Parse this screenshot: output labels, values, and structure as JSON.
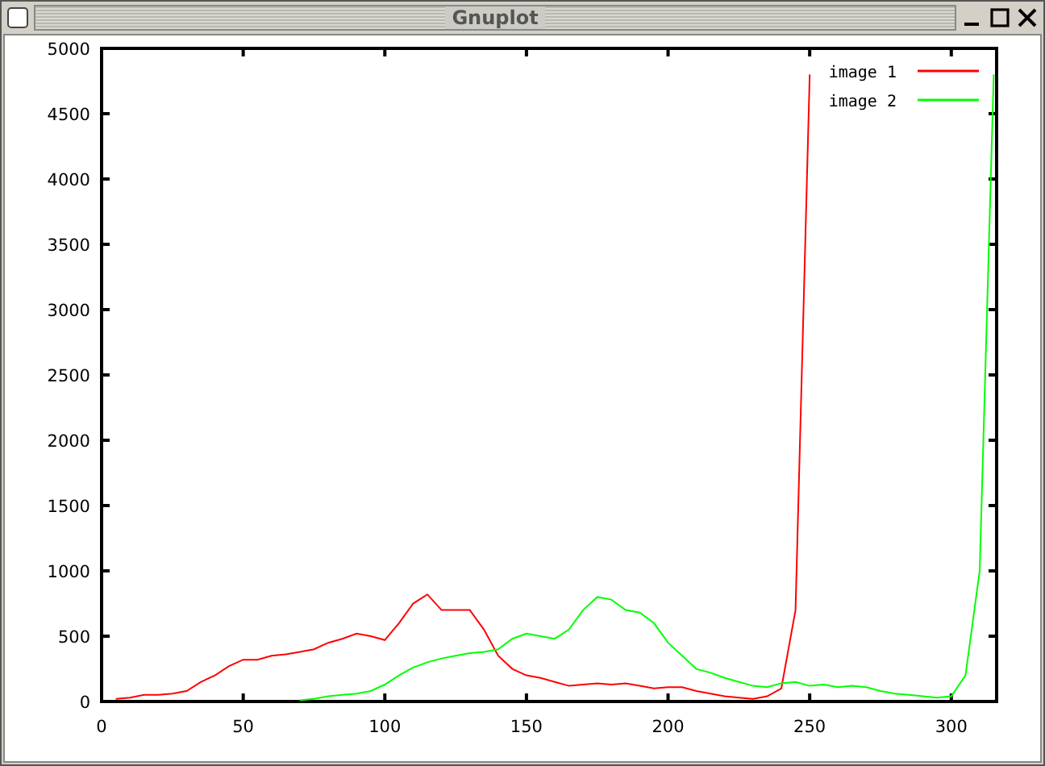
{
  "window": {
    "title": "Gnuplot"
  },
  "plot": {
    "chart_data": {
      "type": "line",
      "x": [
        5,
        10,
        15,
        20,
        25,
        30,
        35,
        40,
        45,
        50,
        55,
        60,
        65,
        70,
        75,
        80,
        85,
        90,
        95,
        100,
        105,
        110,
        115,
        120,
        125,
        130,
        135,
        140,
        145,
        150,
        155,
        160,
        165,
        170,
        175,
        180,
        185,
        190,
        195,
        200,
        205,
        210,
        215,
        220,
        225,
        230,
        235,
        240,
        245,
        250,
        255,
        260,
        265,
        270,
        275,
        280,
        285,
        290,
        295,
        300,
        305,
        310,
        315
      ],
      "series": [
        {
          "name": "image 1",
          "color": "#ff0000",
          "values": [
            20,
            30,
            50,
            50,
            60,
            80,
            150,
            200,
            270,
            320,
            320,
            350,
            360,
            380,
            400,
            450,
            480,
            520,
            500,
            470,
            600,
            750,
            820,
            700,
            700,
            700,
            550,
            350,
            250,
            200,
            180,
            150,
            120,
            130,
            140,
            130,
            140,
            120,
            100,
            110,
            110,
            80,
            60,
            40,
            30,
            20,
            40,
            100,
            700,
            4800,
            null,
            null,
            null,
            null,
            null,
            null,
            null,
            null,
            null,
            null,
            null,
            null,
            null
          ]
        },
        {
          "name": "image 2",
          "color": "#00ff00",
          "values": [
            null,
            null,
            null,
            null,
            null,
            null,
            null,
            null,
            null,
            null,
            null,
            null,
            null,
            10,
            20,
            40,
            50,
            60,
            80,
            130,
            200,
            260,
            300,
            330,
            350,
            370,
            380,
            400,
            480,
            520,
            500,
            480,
            550,
            700,
            800,
            780,
            700,
            680,
            600,
            450,
            350,
            250,
            220,
            180,
            150,
            120,
            110,
            140,
            150,
            120,
            130,
            110,
            120,
            110,
            80,
            60,
            50,
            40,
            30,
            40,
            200,
            1000,
            4800
          ]
        }
      ],
      "xlim": [
        0,
        316
      ],
      "legend": true,
      "ylim": [
        0,
        5000
      ],
      "xticks": [
        0,
        50,
        100,
        150,
        200,
        250,
        300
      ],
      "yticks": [
        0,
        500,
        1000,
        1500,
        2000,
        2500,
        3000,
        3500,
        4000,
        4500,
        5000
      ]
    }
  }
}
